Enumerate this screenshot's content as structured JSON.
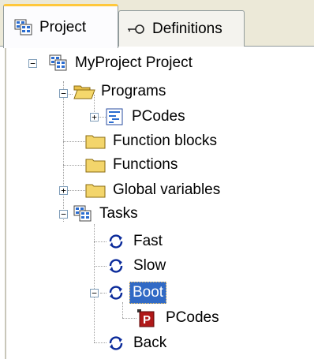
{
  "tabs": [
    {
      "label": "Project",
      "icon": "project-icon",
      "active": true
    },
    {
      "label": "Definitions",
      "icon": "key-icon",
      "active": false
    }
  ],
  "tree": {
    "root": "MyProject Project",
    "programs": "Programs",
    "pcodes": "PCodes",
    "function_blocks": "Function blocks",
    "functions": "Functions",
    "global_variables": "Global variables",
    "tasks": "Tasks",
    "fast": "Fast",
    "slow": "Slow",
    "boot": "Boot",
    "boot_pcodes": "PCodes",
    "back": "Back"
  },
  "colors": {
    "selection": "#316ac5",
    "folder": "#f3d56b",
    "tab_highlight": "#ffc83c",
    "task_cycle": "#0a2a9a",
    "program_badge": "#b01818"
  }
}
